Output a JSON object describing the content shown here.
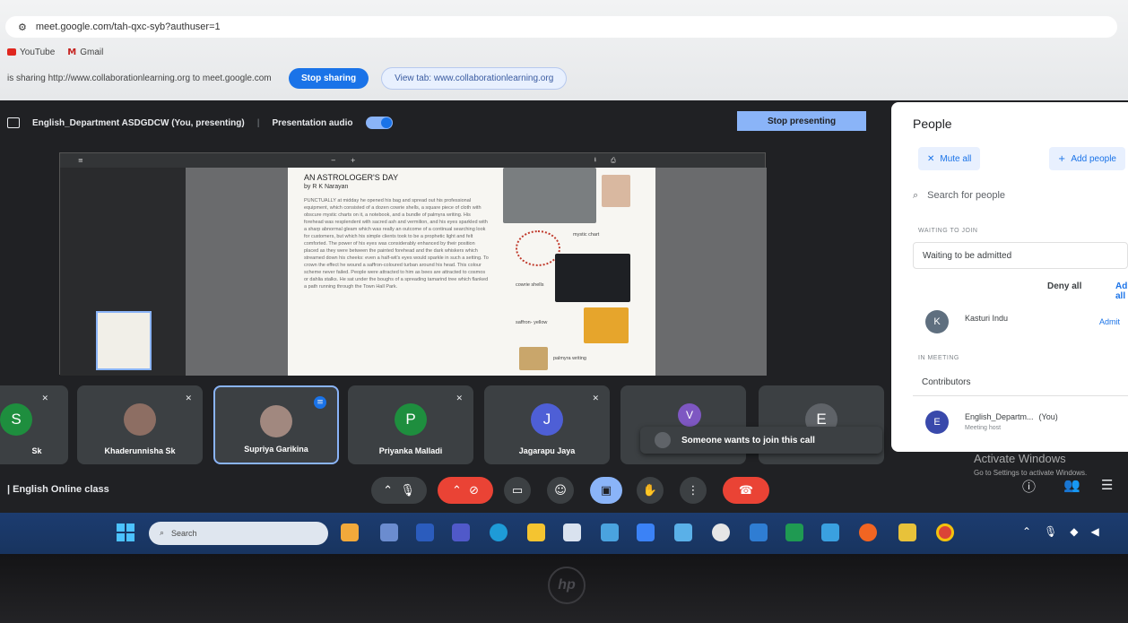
{
  "browser": {
    "url": "meet.google.com/tah-qxc-syb?authuser=1",
    "bookmarks": [
      {
        "label": "YouTube",
        "color": "#e0271f"
      },
      {
        "label": "Gmail",
        "color": "#c5221f"
      }
    ],
    "share_notice": "is sharing http://www.collaborationlearning.org to meet.google.com",
    "stop_sharing_label": "Stop sharing",
    "view_tab_label": "View tab: www.collaborationlearning.org"
  },
  "presenter_bar": {
    "presenter": "English_Department ASDGDCW (You, presenting)",
    "audio_label": "Presentation audio",
    "stop_presenting_label": "Stop presenting"
  },
  "document": {
    "title": "AN ASTROLOGER'S DAY",
    "author": "by R K Narayan",
    "body": "PUNCTUALLY at midday he opened his bag and spread out his professional equipment, which consisted of a dozen cowrie shells, a square piece of cloth with obscure mystic charts on it, a notebook, and a bundle of palmyra writing. His forehead was resplendent with sacred ash and vermilion, and his eyes sparkled with a sharp abnormal gleam which was really an outcome of a continual searching look for customers, but which his simple clients took to be a prophetic light and felt comforted. The power of his eyes was considerably enhanced by their position placed as they were between the painted forehead and the dark whiskers which streamed down his cheeks: even a half-wit's eyes would sparkle in such a setting. To crown the effect he wound a saffron-coloured turban around his head. This colour scheme never failed. People were attracted to him as bees are attracted to cosmos or dahlia stalks. He sat under the boughs of a spreading tamarind tree which flanked a path running through the Town Hall Park.",
    "captions": {
      "mystic_chart": "mystic chart",
      "cowrie_shells": "cowrie shells",
      "saffron": "saffron- yellow",
      "palmyra": "palmyra writing"
    }
  },
  "people_panel": {
    "title": "People",
    "mute_all_label": "Mute all",
    "add_people_label": "Add people",
    "search_placeholder": "Search for people",
    "waiting_header": "WAITING TO JOIN",
    "waiting_label": "Waiting to be admitted",
    "deny_all_label": "Deny all",
    "admit_all_label": "Admit all",
    "waiting_person": {
      "initial": "K",
      "name": "Kasturi Indu",
      "admit_label": "Admit"
    },
    "in_meeting_header": "IN MEETING",
    "contributors_label": "Contributors",
    "host": {
      "initial": "E",
      "name": "English_Departm...",
      "you": "(You)",
      "role": "Meeting host"
    }
  },
  "participants": [
    {
      "name": "Sk",
      "initial": "S",
      "color": "#1e8e3e"
    },
    {
      "name": "Khaderunnisha Sk",
      "initial": "",
      "color": "#8d6e63"
    },
    {
      "name": "Supriya Garikina",
      "initial": "",
      "color": "#a1887f"
    },
    {
      "name": "Priyanka Malladi",
      "initial": "P",
      "color": "#1e8e3e"
    },
    {
      "name": "Jagarapu Jaya",
      "initial": "J",
      "color": "#4e5fd6"
    },
    {
      "name": "",
      "initial": "V",
      "color": "#7e57c2"
    },
    {
      "name": "",
      "initial": "E",
      "color": "#5f6368"
    }
  ],
  "notification": "Someone wants to join this call",
  "meeting_name": "English Online class",
  "windows_activation": {
    "title": "Activate Windows",
    "subtitle": "Go to Settings to activate Windows."
  },
  "taskbar": {
    "search_placeholder": "Search"
  },
  "laptop_brand": "hp",
  "icons": [
    "search-icon",
    "mic-icon",
    "camera-off-icon",
    "captions-icon",
    "emoji-icon",
    "present-icon",
    "raise-hand-icon",
    "more-options-icon",
    "hangup-icon",
    "info-icon",
    "people-icon",
    "chat-icon",
    "windows-start-icon"
  ]
}
